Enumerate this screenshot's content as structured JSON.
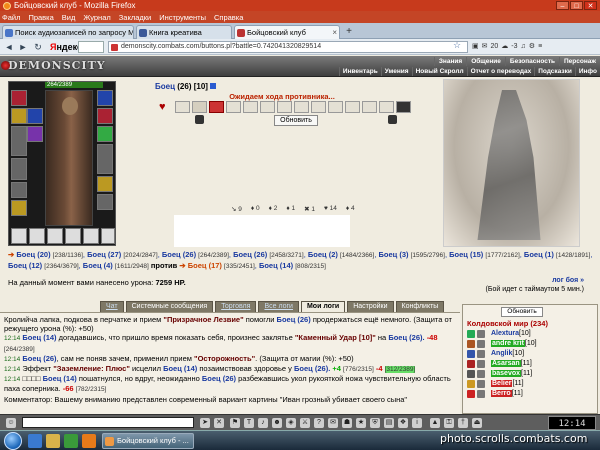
{
  "window": {
    "title": "Бойцовский клуб - Mozilla Firefox",
    "buttons": {
      "minimize": "–",
      "maximize": "□",
      "close": "✕"
    }
  },
  "menu": [
    "Файл",
    "Правка",
    "Вид",
    "Журнал",
    "Закладки",
    "Инструменты",
    "Справка"
  ],
  "tabs": [
    {
      "label": "Поиск аудиозаписей по запросу Ма...",
      "active": false,
      "icon_color": "#4a76c8"
    },
    {
      "label": "Книга креатива",
      "active": false,
      "icon_color": "#3b5998"
    },
    {
      "label": "Бойцовский клуб",
      "active": true,
      "icon_color": "#b33"
    }
  ],
  "navbar": {
    "back": "◄",
    "forward": "►",
    "reload": "↻",
    "yandex_first": "Я",
    "yandex_rest": "ндекс",
    "url": "demonscity.combats.com/buttons.pl?battle=0.742041320829514",
    "star": "☆",
    "right_count": "20",
    "right_num": "-3"
  },
  "game": {
    "logo": "DEMONSCITY",
    "top_menu": [
      "Знания",
      "Общение",
      "Безопасность",
      "Персонаж"
    ],
    "sub_menu": [
      "Инвентарь",
      "Умения",
      "Новый Скролл",
      "Отчет о переводах",
      "Подсказки",
      "Инфо"
    ]
  },
  "character": {
    "hp": "264/2389"
  },
  "opponent": {
    "name": "Боец",
    "level": "(26)",
    "level2": "[10]"
  },
  "battle": {
    "waiting_text": "Ожидаем хода противника...",
    "refresh_label": "Обновить",
    "stats": [
      "↘ 9",
      "♦ 0",
      "♦ 2",
      "♦ 1",
      "✖ 1",
      "♥ 14",
      "♦ 4"
    ]
  },
  "teams": {
    "arrow": "➔",
    "team1": [
      {
        "name": "Боец (20)",
        "hp": "[238/1136]"
      },
      {
        "name": "Боец (27)",
        "hp": "[2024/2847]"
      },
      {
        "name": "Боец (26)",
        "hp": "[264/2389]"
      },
      {
        "name": "Боец (26)",
        "hp": "[2458/3271]"
      },
      {
        "name": "Боец (2)",
        "hp": "[1484/2366]"
      },
      {
        "name": "Боец (3)",
        "hp": "[1595/2796]"
      },
      {
        "name": "Боец (15)",
        "hp": "[1777/2162]"
      },
      {
        "name": "Боец (1)",
        "hp": "[1428/1891]"
      },
      {
        "name": "Боец (12)",
        "hp": "[2364/3679]"
      },
      {
        "name": "Боец (4)",
        "hp": "[1611/2948]"
      }
    ],
    "versus": "против",
    "team2": [
      {
        "name": "Боец (17)",
        "hp": "[335/2451]"
      },
      {
        "name": "Боец (14)",
        "hp": "[808/2315]"
      }
    ]
  },
  "damage": {
    "label": "На данный момент вами нанесено урона:",
    "value": "7259 HP."
  },
  "timeout": {
    "log": "лог боя »",
    "text": "(Бой идет с таймаутом 5 мин.)"
  },
  "bottom_tabs": [
    {
      "label": "Чат",
      "style": "u"
    },
    {
      "label": "Системные сообщения",
      "style": "plain"
    },
    {
      "label": "Торговля",
      "style": "u"
    },
    {
      "label": "Все логи",
      "style": "u"
    },
    {
      "label": "Мои логи",
      "style": "active"
    },
    {
      "label": "Настройки",
      "style": "plain"
    },
    {
      "label": "Конфликты",
      "style": "plain"
    }
  ],
  "chat": {
    "line1": "Кролийча лапка, подкова в перчатке и прием",
    "line1_q": "\"Призрачное Лезвие\"",
    "line1_mid": "помогли",
    "line1_name": "Боец (26)",
    "line1_end": "продержаться ещё немного. (Защита от режущего урона (%): +50)",
    "t2": "12:14",
    "l2_name": "Боец (14)",
    "l2_text": "догадавшись, что пришло время показать себя, произнес заклятье",
    "l2_q": "\"Каменный Удар [10]\"",
    "l2_to": "на",
    "l2_target": "Боец (26).",
    "l2_dmg": "-48",
    "l2_hp": "[264/2389]",
    "t3": "12:14",
    "l3_name": "Боец (26)",
    "l3_text": ", сам не поняв зачем, применил прием",
    "l3_q": "\"Осторожность\"",
    "l3_end": ". (Защита от магии (%): +50)",
    "t4": "12:14",
    "l4_pre": "Эффект",
    "l4_q": "\"Заземление: Плюс\"",
    "l4_mid": "исцелил",
    "l4_name": "Боец (14)",
    "l4_text": "позаимствовав здоровье у",
    "l4_target": "Боец (26).",
    "l4_heal": "+4",
    "l4_hp1": "[776/2315]",
    "l4_dmg": "-4",
    "l4_hp2": "[312/2389]",
    "t5": "12:14",
    "l5_marks": "□□□□",
    "l5_name": "Боец (14)",
    "l5_text": "пошатнулся, но вдруг, неожиданно",
    "l5_target": "Боец (26)",
    "l5_rest": "разбежавшись укол рукояткой ножа чувствительную область паха соперника.",
    "l5_dmg": "-66",
    "l5_hp": "[782/2315]",
    "l6": "Комментатор: Вашему вниманию представлен современный вариант картины \"Иван грозный убивает своего сына\""
  },
  "right_panel": {
    "refresh": "Обновить",
    "title": "Колдовской мир (234)",
    "players": [
      {
        "nick": "Alextura",
        "lvl": "[10]",
        "style": "plain",
        "color": "#2a5"
      },
      {
        "nick": "andre krit",
        "lvl": "[10]",
        "style": "g",
        "color": "#a52"
      },
      {
        "nick": "Anglik",
        "lvl": "[10]",
        "style": "plain",
        "color": "#35a"
      },
      {
        "nick": "Asarsan",
        "lvl": "[11]",
        "style": "g",
        "color": "#a22"
      },
      {
        "nick": "basevox",
        "lvl": "[11]",
        "style": "g",
        "color": "#555"
      },
      {
        "nick": "Belier",
        "lvl": "[11]",
        "style": "r",
        "color": "#c92"
      },
      {
        "nick": "Berro",
        "lvl": "[11]",
        "style": "r",
        "color": "#c22"
      }
    ]
  },
  "clock": "12:14",
  "taskbar": {
    "task": "Бойцовский клуб - ..."
  },
  "watermark": "photo.scrolls.combats.com"
}
